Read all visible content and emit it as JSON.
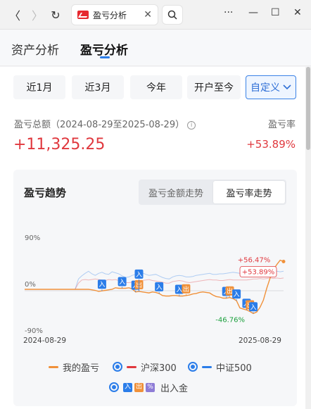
{
  "browser": {
    "tab_title": "盈亏分析",
    "tab_close": "✕",
    "nav_back": "〈",
    "nav_forward": "〉",
    "nav_reload": "↻",
    "win_more": "···",
    "win_minimize": "—",
    "win_maximize": "☐",
    "win_close": "✕"
  },
  "page_tabs": [
    "资产分析",
    "盈亏分析"
  ],
  "range_buttons": [
    "近1月",
    "近3月",
    "今年",
    "开户至今",
    "自定义"
  ],
  "summary": {
    "label": "盈亏总额（2024-08-29至2025-08-29）",
    "info": "i",
    "total": "+11,325.25",
    "ratio_label": "盈亏率",
    "ratio": "+53.89%"
  },
  "card": {
    "title": "盈亏趋势",
    "toggle": [
      "盈亏金额走势",
      "盈亏率走势"
    ]
  },
  "chart_data": {
    "type": "line",
    "x_start_label": "2024-08-29",
    "x_end_label": "2025-08-29",
    "y_ticks": [
      "90%",
      "0%",
      "-90%"
    ],
    "ylim": [
      -90,
      90
    ],
    "series": [
      {
        "name": "我的盈亏",
        "color": "#f0913a",
        "values": [
          0,
          0,
          0,
          0,
          0,
          0,
          0,
          0,
          0,
          0,
          0,
          0,
          0,
          0,
          0,
          0,
          0,
          0,
          0,
          0,
          -1,
          -2,
          -4,
          -3,
          -2,
          -1,
          0,
          3,
          2,
          2,
          2,
          3,
          1,
          -5,
          -4,
          -5,
          -6,
          -7,
          -5,
          -6,
          -8,
          -12,
          -13,
          -13,
          -12,
          -12,
          -13,
          -13,
          -12,
          -11,
          -9,
          -8,
          -6,
          -5,
          -6,
          -7,
          -11,
          -14,
          -15,
          -17,
          -17,
          -16,
          -18,
          -22,
          -36,
          -38,
          -40,
          -43,
          -46.76,
          -44,
          -35,
          -21,
          2,
          22,
          38,
          48,
          56.47,
          53.89
        ]
      },
      {
        "name": "沪深300",
        "color": "#e0383e",
        "values": [
          0,
          0,
          0,
          0,
          0,
          0,
          0,
          0,
          0,
          0,
          0,
          0,
          0,
          0,
          0,
          0,
          12,
          18,
          19,
          18,
          19,
          20,
          19,
          18,
          17,
          19,
          18,
          19,
          17,
          15,
          13,
          13,
          14,
          15,
          16,
          17,
          18,
          19,
          17,
          16,
          15,
          14,
          12,
          12,
          15,
          16,
          17,
          16,
          14,
          13,
          14,
          15,
          16,
          17,
          18,
          19,
          18,
          18,
          17,
          17,
          18,
          19,
          18,
          18,
          18,
          18,
          18,
          19,
          20,
          20,
          21,
          20,
          21,
          22,
          21,
          22,
          21,
          22
        ]
      },
      {
        "name": "中证500",
        "color": "#2b7de9",
        "values": [
          0,
          0,
          0,
          0,
          0,
          0,
          0,
          0,
          0,
          0,
          0,
          0,
          0,
          0,
          0,
          0,
          20,
          26,
          31,
          35,
          30,
          27,
          31,
          33,
          30,
          29,
          34,
          32,
          30,
          26,
          23,
          24,
          27,
          29,
          30,
          32,
          29,
          27,
          28,
          29,
          26,
          23,
          21,
          20,
          24,
          26,
          27,
          26,
          24,
          24,
          25,
          27,
          28,
          29,
          30,
          31,
          29,
          29,
          30,
          30,
          31,
          32,
          33,
          32,
          31,
          31,
          32,
          33,
          34,
          33,
          34,
          33,
          34,
          33,
          34,
          35,
          34,
          35
        ]
      }
    ],
    "annotations": {
      "max": "+56.47%",
      "last": "+53.89%",
      "min": "-46.76%"
    },
    "markers": [
      {
        "text": "入",
        "type": "in",
        "i": 23,
        "dir": "up"
      },
      {
        "text": "入",
        "type": "in",
        "i": 29,
        "dir": "up"
      },
      {
        "text": "入",
        "type": "in",
        "i": 33,
        "dir": "up"
      },
      {
        "text": "出",
        "type": "out",
        "i": 34,
        "dir": "up"
      },
      {
        "text": "入",
        "type": "in",
        "i": 34,
        "dir": "up"
      },
      {
        "text": "入",
        "type": "in",
        "i": 40,
        "dir": "up"
      },
      {
        "text": "入",
        "type": "in",
        "i": 46,
        "dir": "up"
      },
      {
        "text": "出",
        "type": "out",
        "i": 48,
        "dir": "up"
      },
      {
        "text": "入",
        "type": "in",
        "i": 60,
        "dir": "up"
      },
      {
        "text": "出",
        "type": "out",
        "i": 61,
        "dir": "up"
      },
      {
        "text": "入",
        "type": "in",
        "i": 63,
        "dir": "up"
      },
      {
        "text": "入",
        "type": "in",
        "i": 66,
        "dir": "up"
      },
      {
        "text": "出",
        "type": "out",
        "i": 67,
        "dir": "up"
      },
      {
        "text": "入",
        "type": "in",
        "i": 68,
        "dir": "up"
      }
    ]
  },
  "legend": {
    "mine": "我的盈亏",
    "hs300": "沪深300",
    "zz500": "中证500",
    "flow": "出入金",
    "flow_badges": [
      "入",
      "出",
      "%"
    ]
  },
  "colors": {
    "accent": "#2b7de9",
    "up": "#e0383e",
    "down": "#1a9f3c",
    "mine": "#f0913a"
  }
}
